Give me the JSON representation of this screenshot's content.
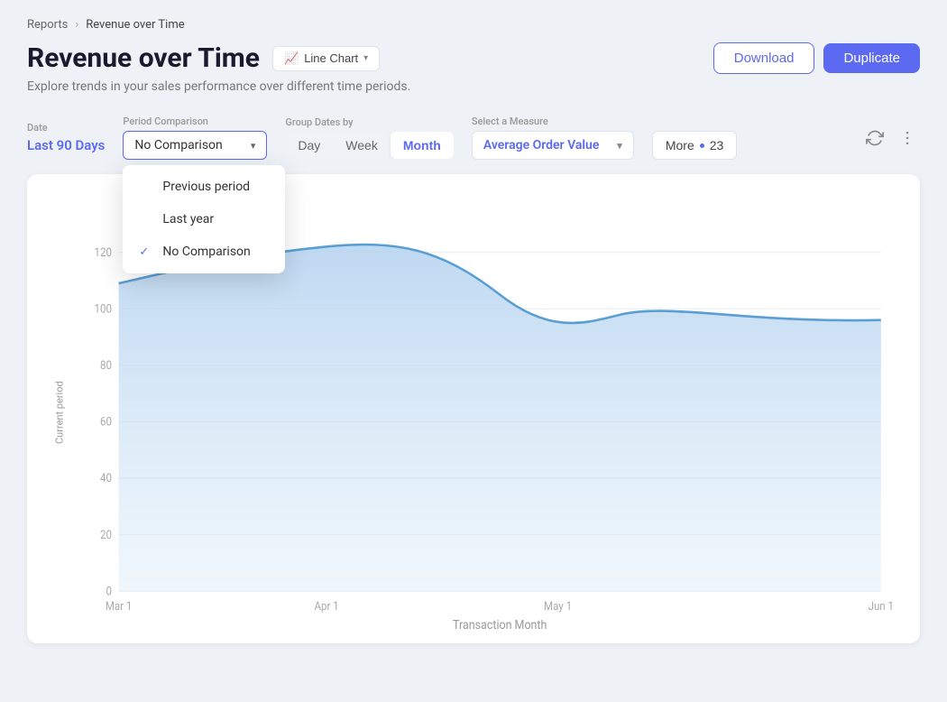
{
  "breadcrumb": {
    "parent": "Reports",
    "current": "Revenue over Time"
  },
  "page": {
    "title": "Revenue over Time",
    "subtitle": "Explore trends in your sales performance over different time periods."
  },
  "chart_type_btn": {
    "label": "Line Chart",
    "icon": "chart-line-icon"
  },
  "header_actions": {
    "download_label": "Download",
    "duplicate_label": "Duplicate"
  },
  "filters": {
    "date_label": "Date",
    "date_value": "Last 90 Days",
    "period_comparison_label": "Period Comparison",
    "period_comparison_value": "No Comparison",
    "group_dates_label": "Group Dates by",
    "group_dates_options": [
      "Day",
      "Week",
      "Month"
    ],
    "group_dates_active": "Month",
    "measure_label": "Select a Measure",
    "measure_value": "Average Order Value",
    "more_label": "More",
    "more_count": "23"
  },
  "dropdown": {
    "items": [
      {
        "label": "Previous period",
        "checked": false
      },
      {
        "label": "Last year",
        "checked": false
      },
      {
        "label": "No Comparison",
        "checked": true
      }
    ]
  },
  "chart": {
    "y_axis_label": "Current period",
    "x_axis_label": "Transaction Month",
    "x_ticks": [
      "Mar 1",
      "Apr 1",
      "May 1",
      "Jun 1"
    ],
    "y_ticks": [
      "0",
      "20",
      "40",
      "60",
      "80",
      "100",
      "120"
    ],
    "accent_color": "#a8c8f0",
    "line_color": "#4a90d9"
  }
}
